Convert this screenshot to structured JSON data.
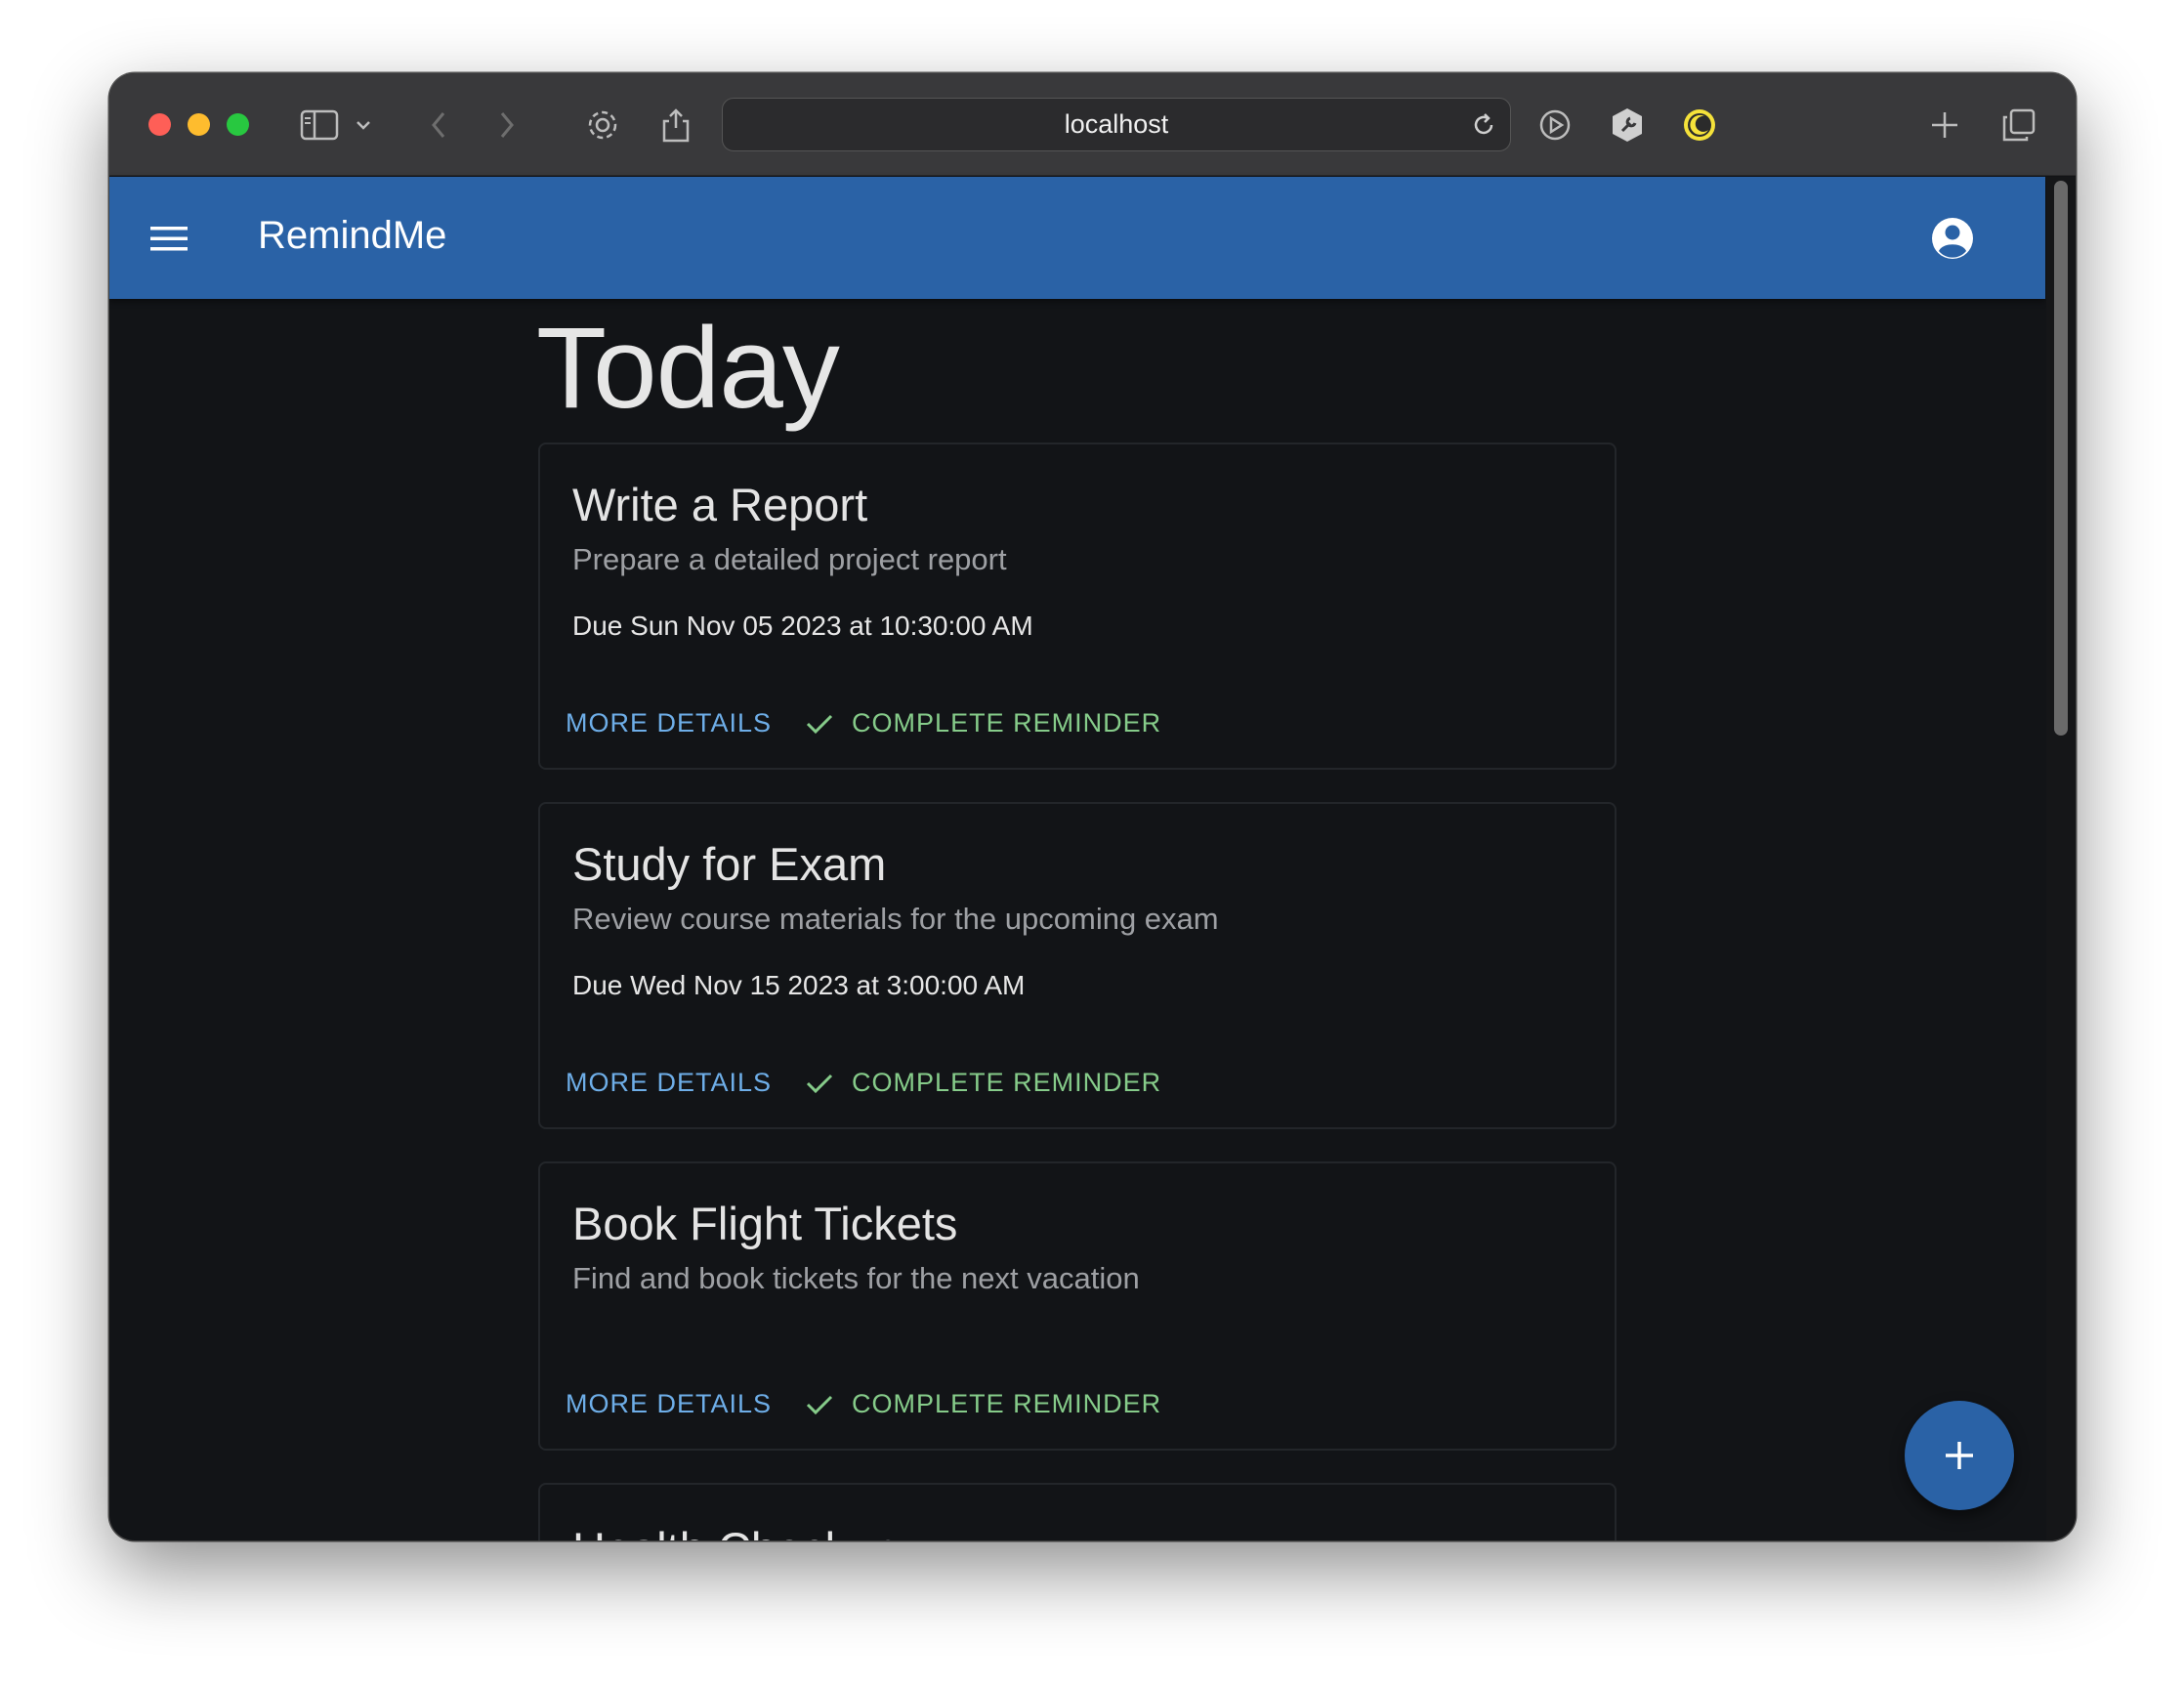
{
  "browser": {
    "url": "localhost"
  },
  "app": {
    "title": "RemindMe"
  },
  "page": {
    "heading": "Today"
  },
  "reminders": [
    {
      "title": "Write a Report",
      "description": "Prepare a detailed project report",
      "due": "Due Sun Nov 05 2023 at 10:30:00 AM"
    },
    {
      "title": "Study for Exam",
      "description": "Review course materials for the upcoming exam",
      "due": "Due Wed Nov 15 2023 at 3:00:00 AM"
    },
    {
      "title": "Book Flight Tickets",
      "description": "Find and book tickets for the next vacation",
      "due": ""
    },
    {
      "title": "Health Checkup",
      "description": "",
      "due": ""
    }
  ],
  "actions": {
    "more_details": "MORE DETAILS",
    "complete_reminder": "COMPLETE REMINDER"
  },
  "colors": {
    "app_bar": "#2a62a6",
    "background": "#121417",
    "details_link": "#6eaee8",
    "complete_link": "#86cc8a"
  },
  "icons": {
    "menu": "menu-icon",
    "account": "account-circle-icon",
    "check": "check-icon",
    "add": "plus-icon"
  }
}
